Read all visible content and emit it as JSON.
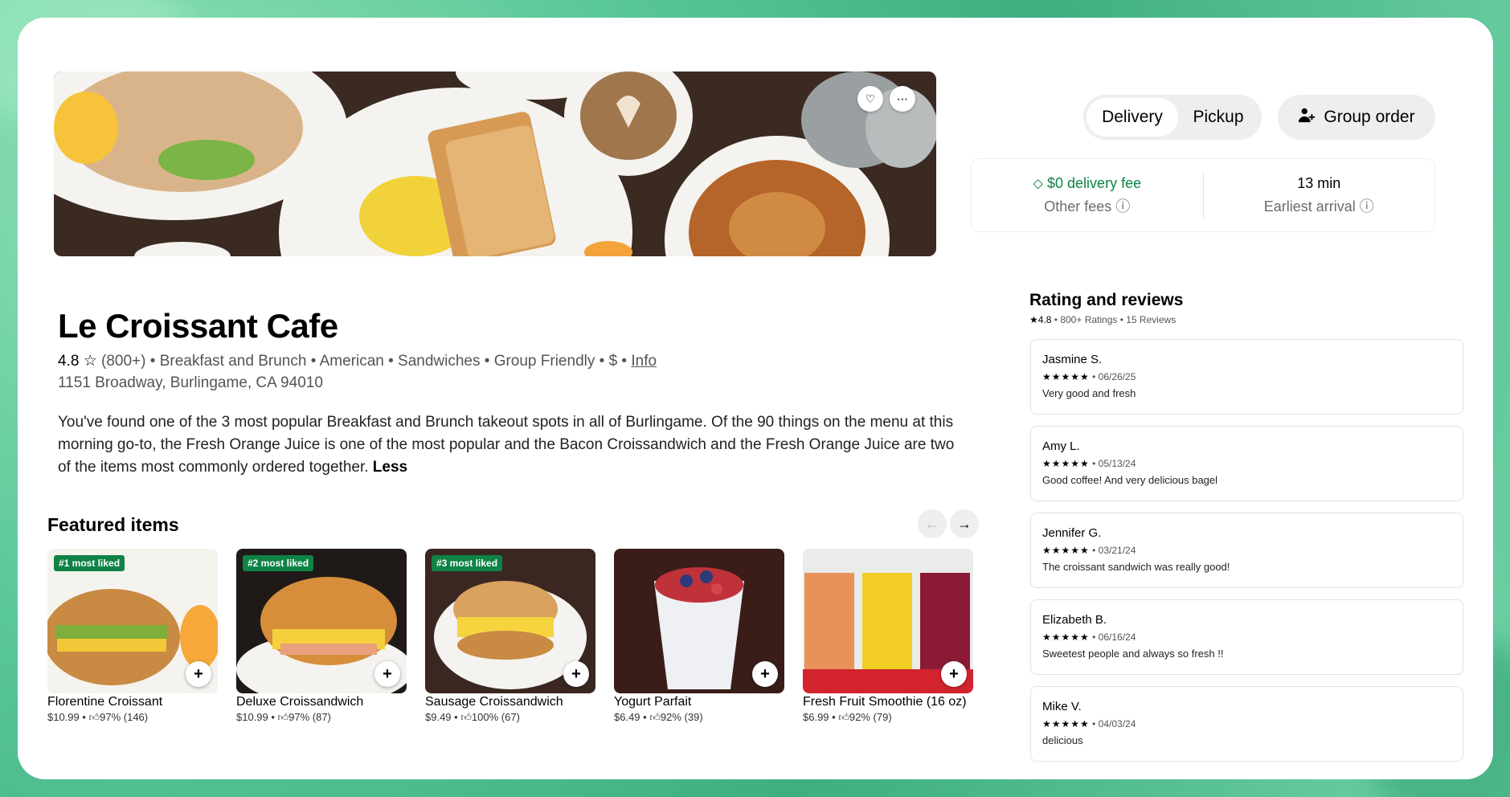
{
  "hero": {
    "favorite_icon": "heart-icon",
    "more_icon": "more-icon"
  },
  "store": {
    "name": "Le Croissant Cafe",
    "rating": "4.8",
    "rating_count": "(800+)",
    "categories": "• Breakfast and Brunch • American • Sandwiches • Group Friendly • $ •",
    "info_link": "Info",
    "address": "1151 Broadway, Burlingame, CA 94010",
    "description": "You've found one of the 3 most popular Breakfast and Brunch takeout spots in all of Burlingame. Of the 90 things on the menu at this morning go-to, the Fresh Orange Juice is one of the most popular and the Bacon Croissandwich and the Fresh Orange Juice are two of the items most commonly ordered together.",
    "less_link": "Less"
  },
  "featured": {
    "title": "Featured items",
    "items": [
      {
        "badge": "#1 most liked",
        "name": "Florentine Croissant",
        "price": "$10.99",
        "likes": "97% (146)"
      },
      {
        "badge": "#2 most liked",
        "name": "Deluxe Croissandwich",
        "price": "$10.99",
        "likes": "97% (87)"
      },
      {
        "badge": "#3 most liked",
        "name": "Sausage Croissandwich",
        "price": "$9.49",
        "likes": "100% (67)"
      },
      {
        "badge": "",
        "name": "Yogurt Parfait",
        "price": "$6.49",
        "likes": "92% (39)"
      },
      {
        "badge": "",
        "name": "Fresh Fruit Smoothie (16 oz)",
        "price": "$6.99",
        "likes": "92% (79)"
      }
    ]
  },
  "order_mode": {
    "delivery": "Delivery",
    "pickup": "Pickup",
    "selected": "Delivery"
  },
  "group_order": {
    "label": "Group order"
  },
  "fees": {
    "delivery_fee": "$0 delivery fee",
    "other_fees": "Other fees",
    "arrival_time": "13 min",
    "arrival_label": "Earliest arrival"
  },
  "reviews": {
    "title": "Rating and reviews",
    "rating": "4.8",
    "summary": "• 800+ Ratings • 15 Reviews",
    "list": [
      {
        "name": "Jasmine S.",
        "stars": "★★★★★",
        "date": "• 06/26/25",
        "text": "Very good and fresh"
      },
      {
        "name": "Amy L.",
        "stars": "★★★★★",
        "date": "• 05/13/24",
        "text": "Good coffee! And very delicious bagel"
      },
      {
        "name": "Jennifer G.",
        "stars": "★★★★★",
        "date": "• 03/21/24",
        "text": "The croissant sandwich was really good!"
      },
      {
        "name": "Elizabeth B.",
        "stars": "★★★★★",
        "date": "• 06/16/24",
        "text": "Sweetest people and always so fresh !!"
      },
      {
        "name": "Mike V.",
        "stars": "★★★★★",
        "date": "• 04/03/24",
        "text": "delicious"
      }
    ]
  },
  "colors": {
    "accent_green": "#0e8345",
    "text_grey": "#545454"
  }
}
